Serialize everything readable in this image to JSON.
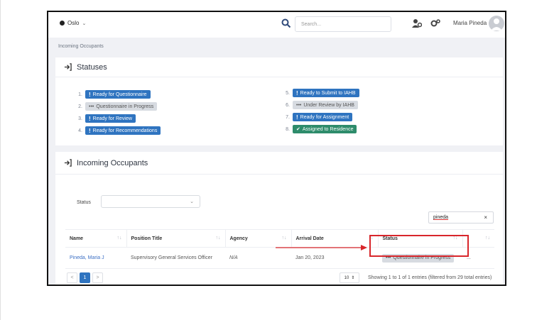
{
  "topbar": {
    "location": "Oslo",
    "search_placeholder": "Search...",
    "user_name": "Maria Pineda"
  },
  "breadcrumb": "Incoming Occupants",
  "statuses_card": {
    "title": "Statuses",
    "left": [
      {
        "num": "1.",
        "label": "Ready for Questionnaire",
        "style": "blue",
        "icon": "exclamation-icon"
      },
      {
        "num": "2.",
        "label": "Questionnaire in Progress",
        "style": "grey",
        "icon": "ellipsis-icon"
      },
      {
        "num": "3.",
        "label": "Ready for Review",
        "style": "blue",
        "icon": "exclamation-icon"
      },
      {
        "num": "4.",
        "label": "Ready for Recommendations",
        "style": "blue",
        "icon": "exclamation-icon"
      }
    ],
    "right": [
      {
        "num": "5.",
        "label": "Ready to Submit to IAHB",
        "style": "blue",
        "icon": "exclamation-icon"
      },
      {
        "num": "6.",
        "label": "Under Review by IAHB",
        "style": "grey",
        "icon": "ellipsis-icon"
      },
      {
        "num": "7.",
        "label": "Ready for Assignment",
        "style": "blue",
        "icon": "exclamation-icon"
      },
      {
        "num": "8.",
        "label": "Assigned to Residence",
        "style": "green",
        "icon": "check-circle-icon"
      }
    ]
  },
  "occupants_card": {
    "title": "Incoming Occupants",
    "filter_label": "Status",
    "filter_value": "",
    "search_value": "pineda",
    "columns": [
      "Name",
      "Position Title",
      "Agency",
      "Arrival Date",
      "Status"
    ],
    "rows": [
      {
        "name": "Pineda, Maria J",
        "position": "Supervisory General Services Officer",
        "agency": "N/A",
        "arrival": "Jan 20, 2023",
        "status": "Questionnaire in Progress",
        "extra": "..."
      }
    ],
    "pager": {
      "prev": "<",
      "current": "1",
      "next": ">"
    },
    "page_size": "10",
    "info": "Showing 1 to 1 of 1 entries (filtered from 29 total entries)"
  },
  "colors": {
    "primary": "#2f74c0",
    "highlight": "#d8262b",
    "green": "#2e8c6b"
  }
}
